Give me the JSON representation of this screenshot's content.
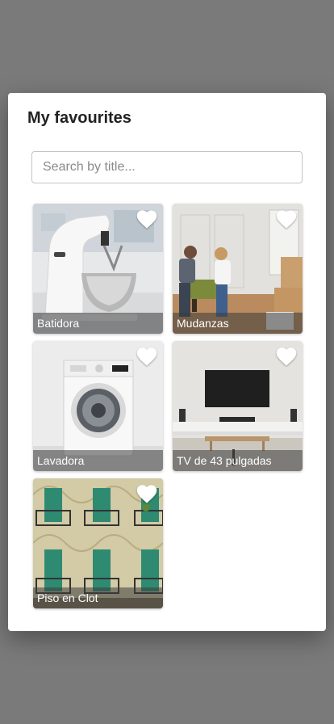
{
  "modal": {
    "title": "My favourites",
    "search_placeholder": "Search by title..."
  },
  "items": [
    {
      "title": "Batidora",
      "favorited": true,
      "image": "stand-mixer"
    },
    {
      "title": "Mudanzas",
      "favorited": true,
      "image": "moving-couple"
    },
    {
      "title": "Lavadora",
      "favorited": true,
      "image": "washing-machine"
    },
    {
      "title": "TV de 43 pulgadas",
      "favorited": true,
      "image": "living-room-tv"
    },
    {
      "title": "Piso en Clot",
      "favorited": true,
      "image": "building-facade"
    }
  ],
  "colors": {
    "backdrop": "#7a7a7a",
    "modal_bg": "#ffffff",
    "heart": "#ffffff"
  }
}
